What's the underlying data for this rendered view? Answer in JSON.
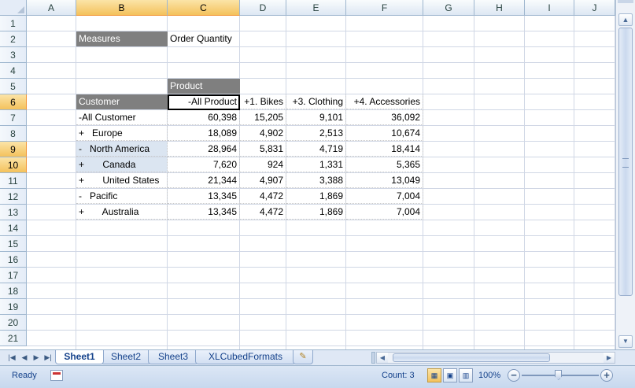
{
  "columns": [
    "A",
    "B",
    "C",
    "D",
    "E",
    "F",
    "G",
    "H",
    "I",
    "J"
  ],
  "rows": [
    "1",
    "2",
    "3",
    "4",
    "5",
    "6",
    "7",
    "8",
    "9",
    "10",
    "11",
    "12",
    "13",
    "14",
    "15",
    "16",
    "17",
    "18",
    "19",
    "20",
    "21"
  ],
  "name_box_selection": {
    "selected_columns": [
      "B",
      "C"
    ],
    "selected_rows": [
      "6",
      "9",
      "10"
    ]
  },
  "pivot": {
    "measures_label": "Measures",
    "measures_value": "Order Quantity",
    "product_label": "Product",
    "customer_label": "Customer",
    "column_headers": [
      "-All Product",
      "+1. Bikes",
      "+3. Clothing",
      "+4. Accessories"
    ],
    "rows": [
      {
        "label": "-All Customer",
        "values": [
          "60,398",
          "15,205",
          "9,101",
          "36,092"
        ]
      },
      {
        "label": "+   Europe",
        "values": [
          "18,089",
          "4,902",
          "2,513",
          "10,674"
        ]
      },
      {
        "label": "-   North America",
        "values": [
          "28,964",
          "5,831",
          "4,719",
          "18,414"
        ]
      },
      {
        "label": "+       Canada",
        "values": [
          "7,620",
          "924",
          "1,331",
          "5,365"
        ]
      },
      {
        "label": "+       United States",
        "values": [
          "21,344",
          "4,907",
          "3,388",
          "13,049"
        ]
      },
      {
        "label": "-   Pacific",
        "values": [
          "13,345",
          "4,472",
          "1,869",
          "7,004"
        ]
      },
      {
        "label": "+       Australia",
        "values": [
          "13,345",
          "4,472",
          "1,869",
          "7,004"
        ]
      }
    ]
  },
  "sheet_tabs": [
    {
      "label": "Sheet1",
      "active": true
    },
    {
      "label": "Sheet2",
      "active": false
    },
    {
      "label": "Sheet3",
      "active": false
    },
    {
      "label": "XLCubedFormats",
      "active": false
    }
  ],
  "status": {
    "ready": "Ready",
    "count": "Count: 3",
    "zoom": "100%"
  },
  "icons": {
    "nav_first": "first-sheet-icon",
    "nav_prev": "prev-sheet-icon",
    "nav_next": "next-sheet-icon",
    "nav_last": "last-sheet-icon",
    "new_sheet": "insert-sheet-icon",
    "macro": "macro-record-icon",
    "normal_view": "normal-view-icon",
    "page_layout_view": "page-layout-view-icon",
    "page_break_view": "page-break-view-icon",
    "zoom_out": "zoom-out-icon",
    "zoom_in": "zoom-in-icon"
  },
  "colors": {
    "header_fill": "#7f7f7f",
    "selection_header": "#f4c25c",
    "gridline": "#d0d7e5"
  }
}
